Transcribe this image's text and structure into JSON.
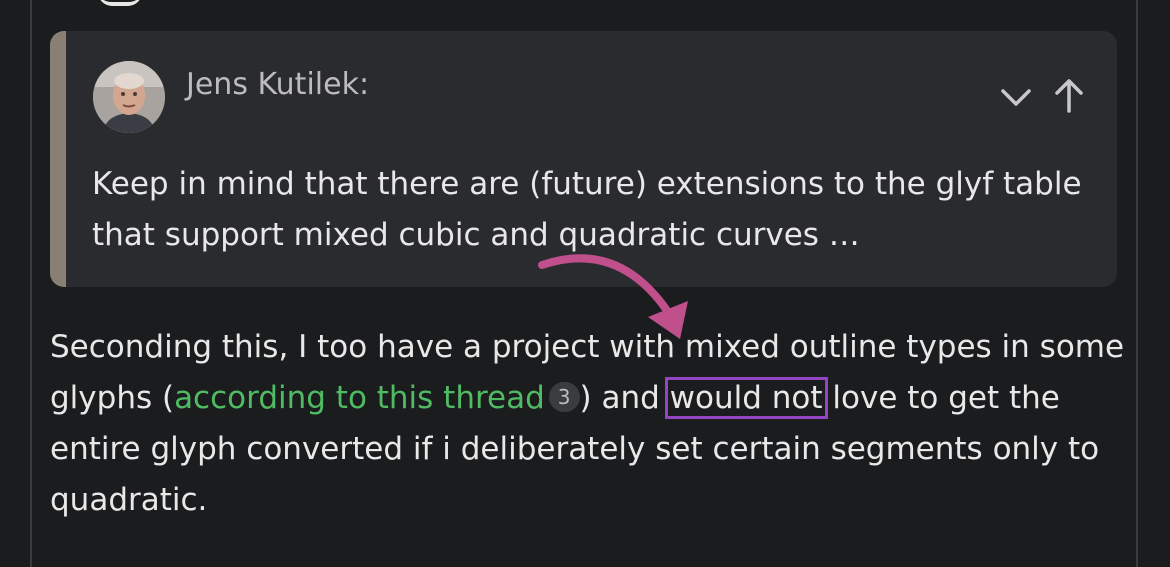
{
  "quote": {
    "author": "Jens Kutilek:",
    "text_line1": "Keep in mind that there are (future) extensions to the glyf table",
    "text_line2": "that support mixed cubic and quadratic curves …",
    "expand_icon": "chevron-down-icon",
    "jump_icon": "arrow-up-icon",
    "bar_color": "#8a7f74"
  },
  "reply": {
    "part1": "Seconding this, I too have a project with mixed outline types in some glyphs (",
    "link_text": "according to this thread",
    "link_count": "3",
    "part2": ") and ",
    "highlight": "would not",
    "part3": " love to get the entire glyph converted if i deliberately set certain segments only to quadratic."
  },
  "colors": {
    "link": "#4fbb62",
    "highlight_box": "#9445c2",
    "annotation_arrow": "#c0508c"
  }
}
